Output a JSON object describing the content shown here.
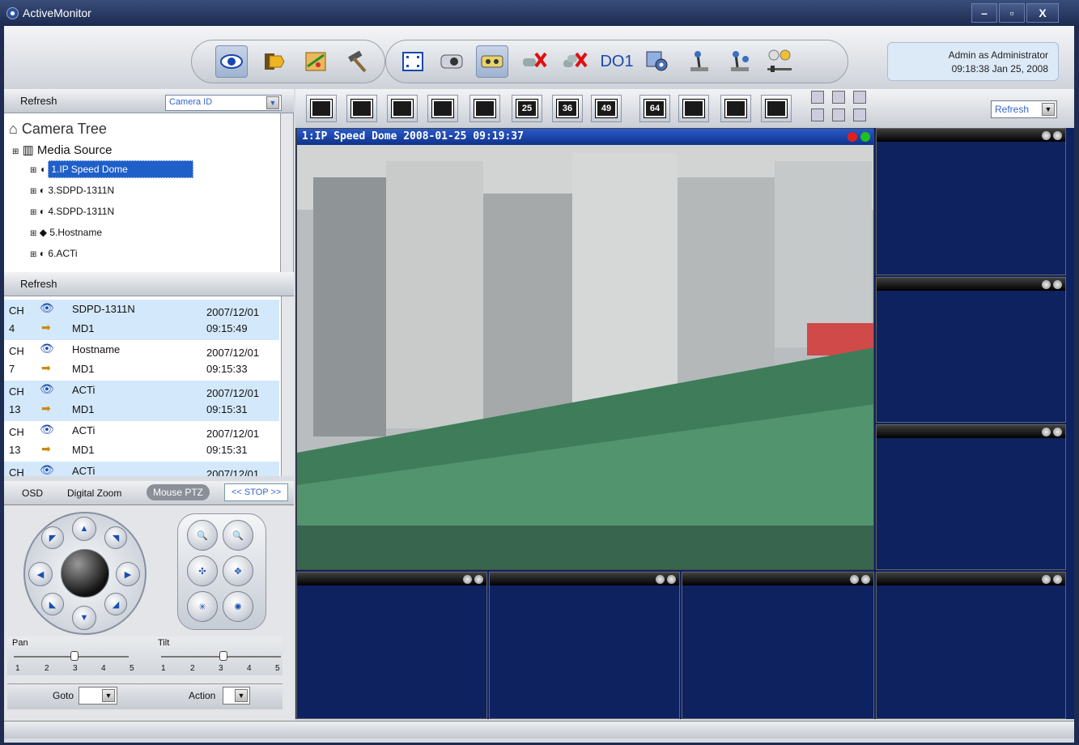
{
  "window": {
    "title": "ActiveMonitor",
    "minimize": "–",
    "restore": "▫",
    "close": "X"
  },
  "toolbar": {
    "group1": [
      "eye-icon",
      "tag-icon",
      "map-icon",
      "hammer-icon"
    ],
    "group2": [
      "fullscreen-icon",
      "camera-icon",
      "record-icon",
      "disconnect-icon",
      "disconnect-all-icon",
      "do-icon",
      "settings-icon",
      "joystick-icon",
      "ptz-icon",
      "audio-icon"
    ],
    "do_label": "DO1"
  },
  "user": {
    "line1": "Admin as Administrator",
    "line2": "09:18:38 Jan 25, 2008"
  },
  "camera_panel": {
    "refresh": "Refresh",
    "select_value": "Camera ID",
    "tree_title": "Camera Tree",
    "media_source": "Media Source",
    "nodes": [
      "1.IP Speed Dome",
      "3.SDPD-1311N",
      "4.SDPD-1311N",
      "5.Hostname",
      "6.ACTi"
    ]
  },
  "event_panel": {
    "refresh": "Refresh",
    "rows": [
      {
        "ch": "CH",
        "num": "4",
        "name": "SDPD-1311N",
        "type": "MD1",
        "date": "2007/12/01",
        "time": "09:15:49"
      },
      {
        "ch": "CH",
        "num": "7",
        "name": "Hostname",
        "type": "MD1",
        "date": "2007/12/01",
        "time": "09:15:33"
      },
      {
        "ch": "CH",
        "num": "13",
        "name": "ACTi",
        "type": "MD1",
        "date": "2007/12/01",
        "time": "09:15:31"
      },
      {
        "ch": "CH",
        "num": "13",
        "name": "ACTi",
        "type": "MD1",
        "date": "2007/12/01",
        "time": "09:15:31"
      },
      {
        "ch": "CH",
        "num": "",
        "name": "ACTi",
        "type": "",
        "date": "2007/12/01",
        "time": ""
      }
    ]
  },
  "ptz": {
    "tabs": [
      "OSD",
      "Digital Zoom",
      "Mouse PTZ",
      "<< STOP >>"
    ],
    "pan_label": "Pan",
    "tilt_label": "Tilt",
    "ticks": [
      "1",
      "2",
      "3",
      "4",
      "5"
    ],
    "goto_label": "Goto",
    "action_label": "Action",
    "pan_value": 3,
    "tilt_value": 3
  },
  "layouts": {
    "buttons": [
      "",
      "",
      "",
      "",
      "",
      "25",
      "36",
      "49",
      "64",
      "",
      "",
      ""
    ],
    "refresh": "Refresh"
  },
  "video": {
    "main_title": "1:IP Speed Dome   2008-01-25 09:19:37"
  },
  "colors": {
    "video_bg": "#0e2260",
    "title_bar": "#1a3a9a"
  }
}
